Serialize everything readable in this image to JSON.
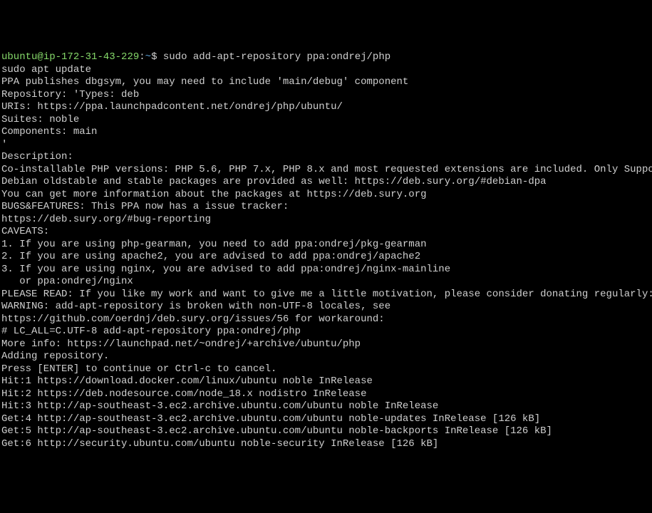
{
  "prompt": {
    "user": "ubuntu",
    "host": "ip-172-31-43-229",
    "path": "~",
    "separator": "$",
    "command": "sudo add-apt-repository ppa:ondrej/php"
  },
  "lines": [
    "sudo apt update",
    "PPA publishes dbgsym, you may need to include 'main/debug' component",
    "Repository: 'Types: deb",
    "URIs: https://ppa.launchpadcontent.net/ondrej/php/ubuntu/",
    "Suites: noble",
    "Components: main",
    "'",
    "Description:",
    "Co-installable PHP versions: PHP 5.6, PHP 7.x, PHP 8.x and most requested extensions are included. Only Supported U",
    "",
    "Debian oldstable and stable packages are provided as well: https://deb.sury.org/#debian-dpa",
    "",
    "You can get more information about the packages at https://deb.sury.org",
    "",
    "BUGS&FEATURES: This PPA now has a issue tracker:",
    "https://deb.sury.org/#bug-reporting",
    "",
    "CAVEATS:",
    "1. If you are using php-gearman, you need to add ppa:ondrej/pkg-gearman",
    "2. If you are using apache2, you are advised to add ppa:ondrej/apache2",
    "3. If you are using nginx, you are advised to add ppa:ondrej/nginx-mainline",
    "   or ppa:ondrej/nginx",
    "",
    "PLEASE READ: If you like my work and want to give me a little motivation, please consider donating regularly: https",
    "",
    "WARNING: add-apt-repository is broken with non-UTF-8 locales, see",
    "https://github.com/oerdnj/deb.sury.org/issues/56 for workaround:",
    "",
    "# LC_ALL=C.UTF-8 add-apt-repository ppa:ondrej/php",
    "More info: https://launchpad.net/~ondrej/+archive/ubuntu/php",
    "Adding repository.",
    "Press [ENTER] to continue or Ctrl-c to cancel.",
    "Hit:1 https://download.docker.com/linux/ubuntu noble InRelease",
    "Hit:2 https://deb.nodesource.com/node_18.x nodistro InRelease",
    "Hit:3 http://ap-southeast-3.ec2.archive.ubuntu.com/ubuntu noble InRelease",
    "Get:4 http://ap-southeast-3.ec2.archive.ubuntu.com/ubuntu noble-updates InRelease [126 kB]",
    "Get:5 http://ap-southeast-3.ec2.archive.ubuntu.com/ubuntu noble-backports InRelease [126 kB]",
    "Get:6 http://security.ubuntu.com/ubuntu noble-security InRelease [126 kB]"
  ]
}
